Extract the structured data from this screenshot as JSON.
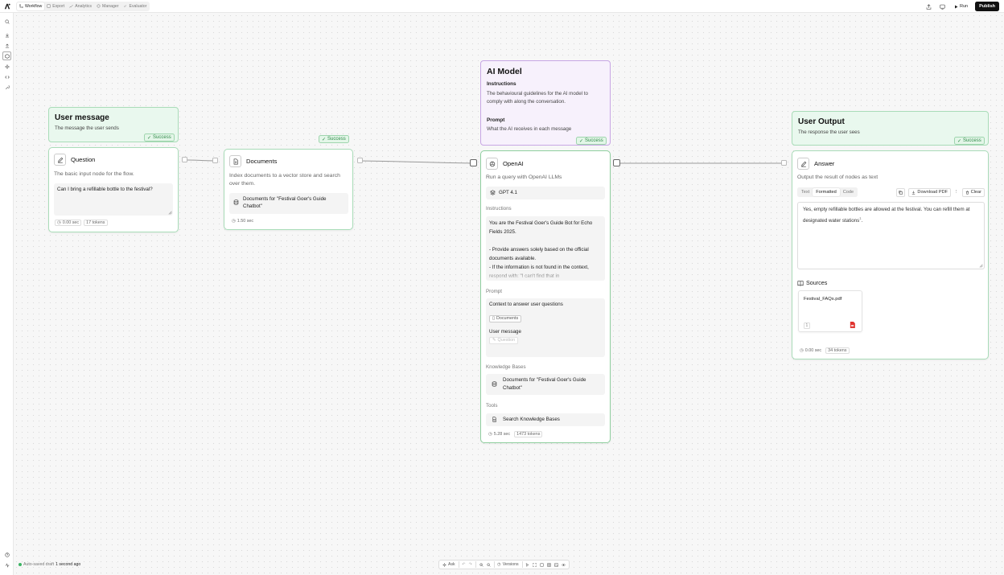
{
  "topbar": {
    "tabs": [
      {
        "label": "Workflow",
        "active": true
      },
      {
        "label": "Export",
        "active": false
      },
      {
        "label": "Analytics",
        "active": false
      },
      {
        "label": "Manager",
        "active": false
      },
      {
        "label": "Evaluator",
        "active": false
      }
    ],
    "run_label": "Run",
    "publish_label": "Publish"
  },
  "status_label": "Success",
  "user_message": {
    "title": "User message",
    "subtitle": "The message the user sends",
    "node_title": "Question",
    "description": "The basic input node for the flow.",
    "input_value": "Can I bring a refillable bottle to the festival?",
    "stats": [
      "0.00 sec",
      "17 tokens"
    ]
  },
  "documents": {
    "node_title": "Documents",
    "description": "Index documents to a vector store and search over them.",
    "field_value": "Documents for \"Festival Goer's Guide Chatbot\"",
    "stats": [
      "1.50 sec"
    ]
  },
  "ai_model": {
    "title": "AI Model",
    "instructions_heading": "Instructions",
    "instructions_text": "The behavioural guidelines for the AI model to comply with along the conversation.",
    "prompt_heading": "Prompt",
    "prompt_text": "What the AI receives in each message"
  },
  "openai": {
    "node_title": "OpenAI",
    "description": "Run a query with OpenAI LLMs",
    "model": "GPT 4.1",
    "instructions_label": "Instructions",
    "instructions_lines": [
      "You are the Festival Goer's Guide Bot for Echo Fields 2025.",
      "",
      "- Provide answers solely based on the official documents available.",
      "- If the information is not found in the context, respond with: \"I can't find that in"
    ],
    "prompt_label": "Prompt",
    "prompt_context": "Context to answer user questions",
    "prompt_chip_documents": "Documents",
    "prompt_user_message": "User message",
    "prompt_chip_question": "Question",
    "kb_label": "Knowledge Bases",
    "kb_value": "Documents for \"Festival Goer's Guide Chatbot\"",
    "tools_label": "Tools",
    "tool_value": "Search Knowledge Bases",
    "stats": [
      "5.28 sec",
      "1473 tokens"
    ]
  },
  "user_output": {
    "title": "User Output",
    "subtitle": "The response the user sees",
    "node_title": "Answer",
    "description": "Output the result of nodes as text",
    "modes": [
      "Text",
      "Formatted",
      "Code"
    ],
    "active_mode": "Formatted",
    "download_label": "Download PDF",
    "clear_label": "Clear",
    "answer_text": "Yes, empty refillable bottles are allowed at the festival. You can refill them at designated water stations",
    "answer_citation": "1",
    "sources_label": "Sources",
    "source_file": "Festival_FAQs.pdf",
    "source_index": "1",
    "stats": [
      "0.00 sec",
      "34 tokens"
    ]
  },
  "bottom": {
    "status_prefix": "Auto-saved draft",
    "status_time": "1 second ago",
    "ask_label": "Ask",
    "versions_label": "Versions"
  },
  "colors": {
    "success_green": "#2f8a48",
    "node_border_green": "#a9dcb8",
    "ai_border_purple": "#c7a6e4",
    "publish_bg": "#111111"
  }
}
